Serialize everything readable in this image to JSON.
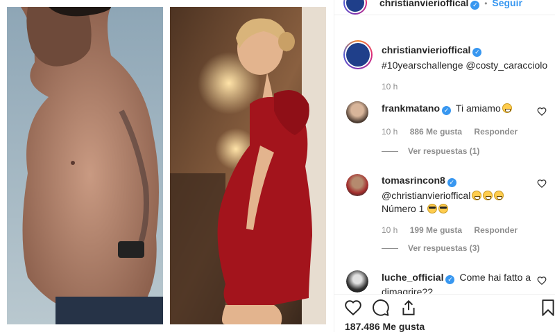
{
  "post": {
    "author": "christianvierioffical",
    "follow_label": "Seguir",
    "dot": "•",
    "likes": "187.486 Me gusta"
  },
  "caption": {
    "username": "christianvierioffical",
    "text": "#10yearschallenge @costy_caracciolo",
    "time": "10 h"
  },
  "comments": [
    {
      "username": "frankmatano",
      "text": "Ti amiamo",
      "emoji": "grin",
      "time": "10 h",
      "likes": "886 Me gusta",
      "reply": "Responder",
      "view_replies": "Ver respuestas (1)"
    },
    {
      "username": "tomasrincon8",
      "text": "@christianvierioffical",
      "text2": "Número 1",
      "time": "10 h",
      "likes": "199 Me gusta",
      "reply": "Responder",
      "view_replies": "Ver respuestas (3)"
    },
    {
      "username": "luche_official",
      "text": "Come hai fatto a",
      "text2": "dimagrire??"
    }
  ],
  "icons": {
    "verified": "verified-badge-icon",
    "heart": "heart-icon",
    "comment": "comment-icon",
    "share": "share-icon",
    "save": "bookmark-icon"
  },
  "colors": {
    "link": "#3897f0",
    "muted": "#8e8e8e",
    "text": "#262626",
    "dress": "#a3141c"
  }
}
